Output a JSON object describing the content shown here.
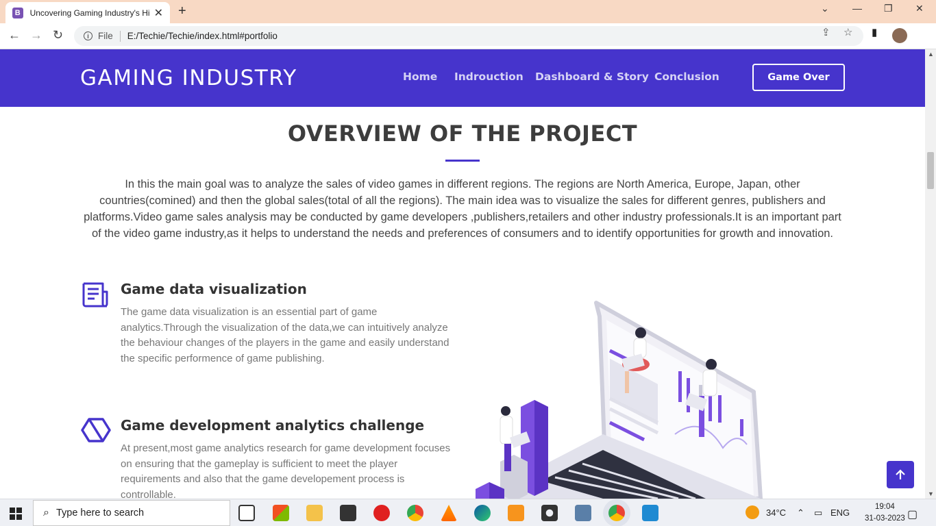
{
  "browser": {
    "tab_title": "Uncovering Gaming Industry's Hi",
    "tab_favicon": "B",
    "url_scheme_label": "File",
    "url": "E:/Techie/Techie/index.html#portfolio"
  },
  "site": {
    "logo": "GAMING INDUSTRY",
    "nav": [
      "Home",
      "Indrouction",
      "Dashboard & Story",
      "Conclusion"
    ],
    "cta": "Game Over",
    "accent_color": "#4634cc"
  },
  "section": {
    "title": "OVERVIEW OF THE PROJECT",
    "intro": "In this the main goal was to analyze the sales of video games in different regions. The regions are North America, Europe, Japan, other countries(comined) and then the global sales(total of all the regions). The main idea was to visualize the sales for different genres, publishers and platforms.Video game sales analysis may be conducted by game developers ,publishers,retailers and other industry professionals.It is an important part of the video game industry,as it helps to understand the needs and preferences of consumers and to identify opportunities for growth and innovation."
  },
  "features": [
    {
      "icon": "newspaper-icon",
      "title": "Game data visualization",
      "text": "The game data visualization is an essential part of game analytics.Through the visualization of the data,we can intuitively analyze the behaviour changes of the players in the game and easily understand the specific performence of game publishing."
    },
    {
      "icon": "hexagon-icon",
      "title": "Game development analytics challenge",
      "text": "At present,most game analytics research for game development focuses on ensuring that the gameplay is sufficient to meet the player requirements and also that the game developement process is controllable."
    }
  ],
  "taskbar": {
    "search_placeholder": "Type here to search",
    "weather": "34°C",
    "language": "ENG",
    "time": "19:04",
    "date": "31-03-2023"
  }
}
